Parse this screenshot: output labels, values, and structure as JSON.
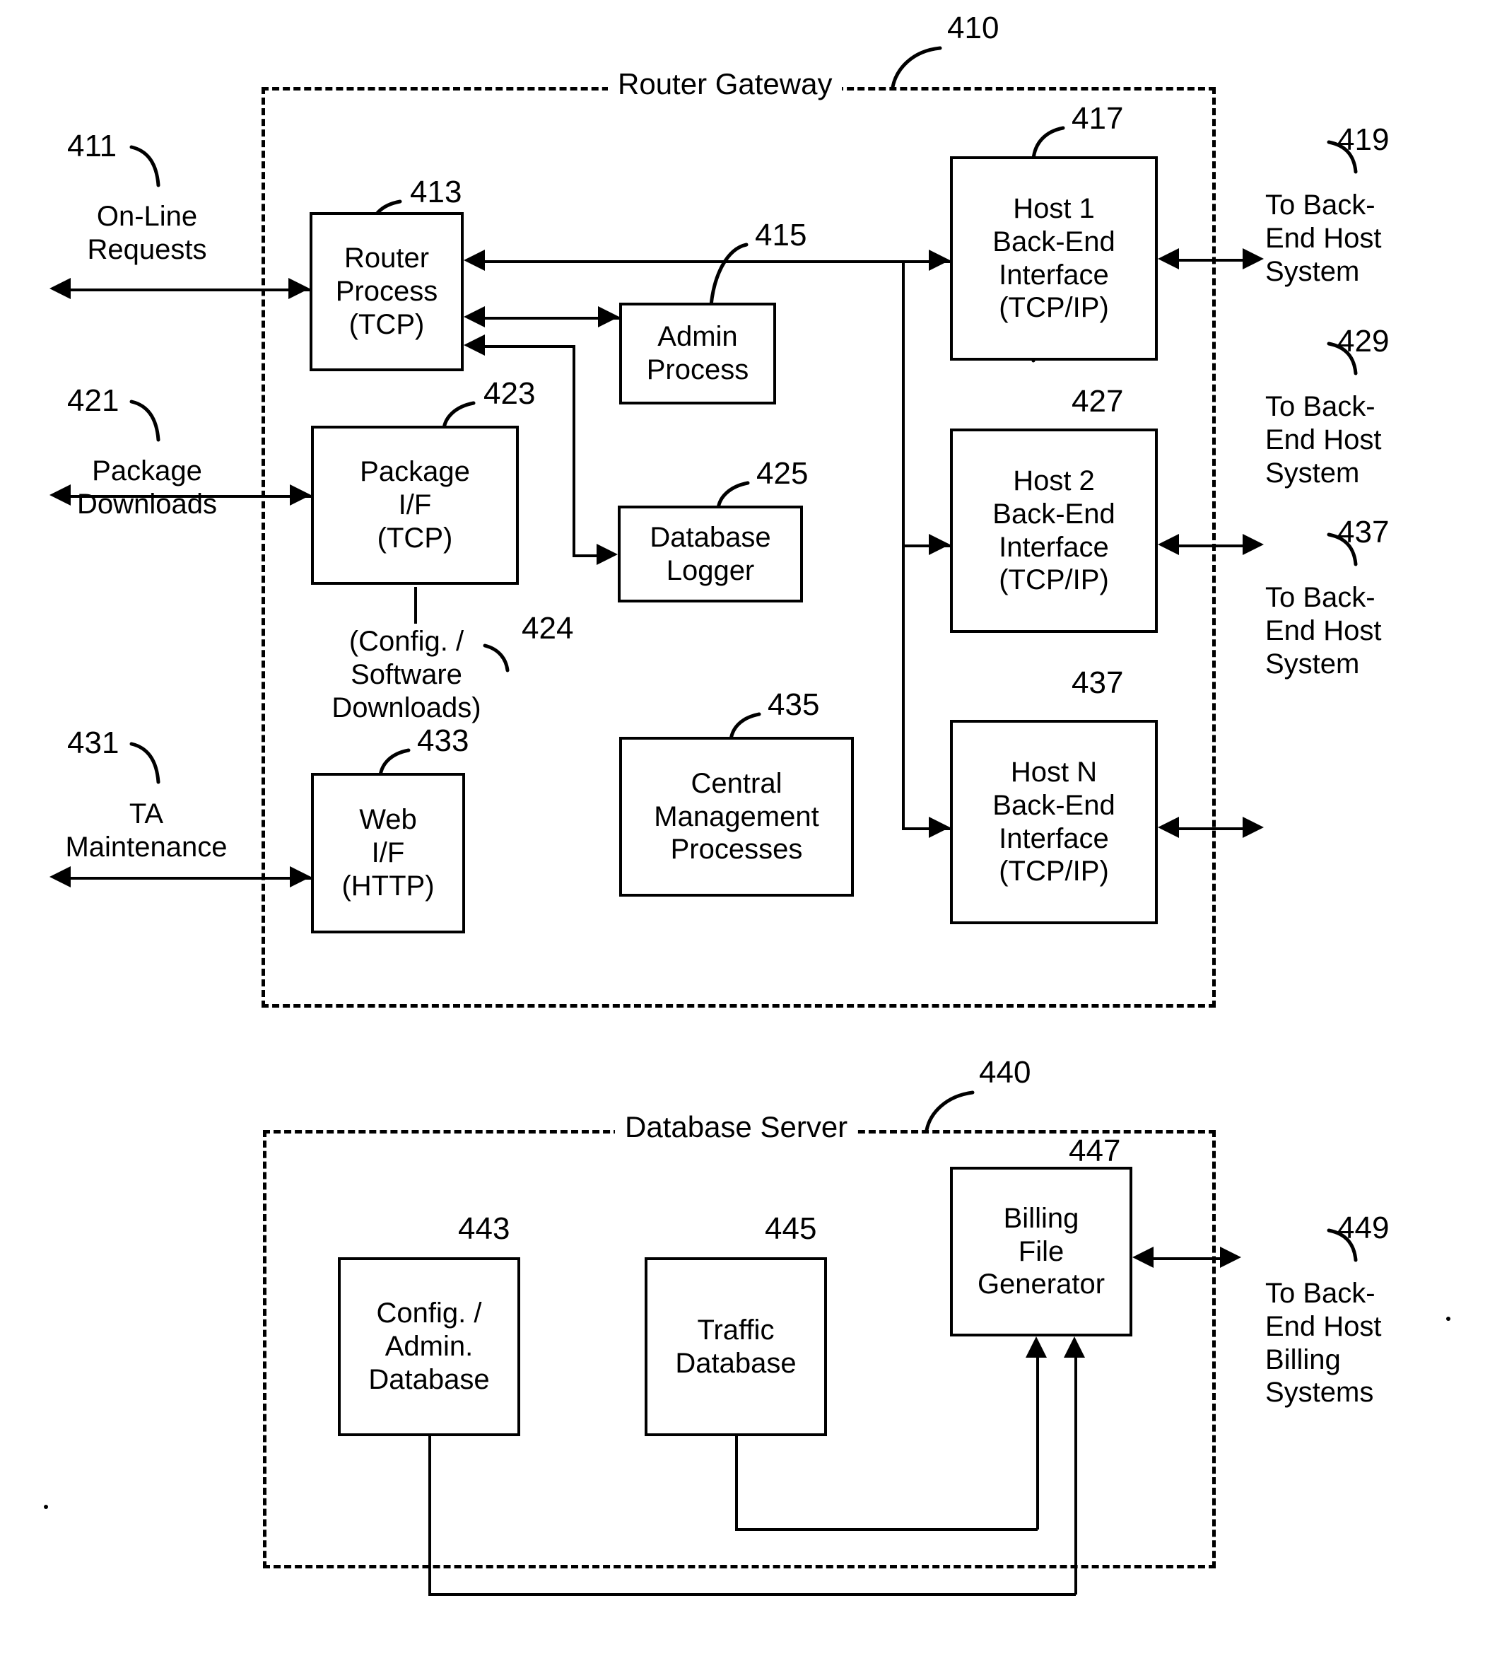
{
  "figure": {
    "title": "Router Gateway and Database Server block diagram"
  },
  "enclosures": [
    {
      "id": "router-gateway",
      "title": "Router Gateway",
      "ref": "410"
    },
    {
      "id": "database-server",
      "title": "Database Server",
      "ref": "440"
    }
  ],
  "boxes": [
    {
      "id": "router-process",
      "ref": "413",
      "label": "Router\nProcess\n(TCP)"
    },
    {
      "id": "admin-process",
      "ref": "415",
      "label": "Admin\nProcess"
    },
    {
      "id": "package-if",
      "ref": "423",
      "label": "Package\nI/F\n(TCP)"
    },
    {
      "id": "database-logger",
      "ref": "425",
      "label": "Database\nLogger"
    },
    {
      "id": "web-if",
      "ref": "433",
      "label": "Web\nI/F\n(HTTP)"
    },
    {
      "id": "central-mgmt",
      "ref": "435",
      "label": "Central\nManagement\nProcesses"
    },
    {
      "id": "host1-backend",
      "ref": "417",
      "label": "Host 1\nBack-End\nInterface\n(TCP/IP)"
    },
    {
      "id": "host2-backend",
      "ref": "427",
      "label": "Host 2\nBack-End\nInterface\n(TCP/IP)"
    },
    {
      "id": "hostn-backend",
      "ref": "437",
      "label": "Host N\nBack-End\nInterface\n(TCP/IP)"
    },
    {
      "id": "config-admin-db",
      "ref": "443",
      "label": "Config. /\nAdmin.\nDatabase"
    },
    {
      "id": "traffic-db",
      "ref": "445",
      "label": "Traffic\nDatabase"
    },
    {
      "id": "billing-file-gen",
      "ref": "447",
      "label": "Billing\nFile\nGenerator"
    }
  ],
  "external_labels": [
    {
      "id": "online-requests",
      "ref": "411",
      "label": "On-Line\nRequests"
    },
    {
      "id": "package-downloads",
      "ref": "421",
      "label": "Package\nDownloads"
    },
    {
      "id": "ta-maintenance",
      "ref": "431",
      "label": "TA\nMaintenance"
    },
    {
      "id": "config-software-dl",
      "ref": "424",
      "label": "(Config. /\nSoftware\nDownloads)"
    },
    {
      "id": "to-backend-host-1",
      "ref": "419",
      "label": "To Back-\nEnd Host\nSystem"
    },
    {
      "id": "to-backend-host-2",
      "ref": "429",
      "label": "To Back-\nEnd Host\nSystem"
    },
    {
      "id": "to-backend-host-n",
      "ref": "437",
      "label": "To Back-\nEnd Host\nSystem"
    },
    {
      "id": "to-backend-billing",
      "ref": "449",
      "label": "To Back-\nEnd Host\nBilling\nSystems"
    }
  ],
  "colors": {
    "stroke": "#000000",
    "background": "#ffffff"
  }
}
